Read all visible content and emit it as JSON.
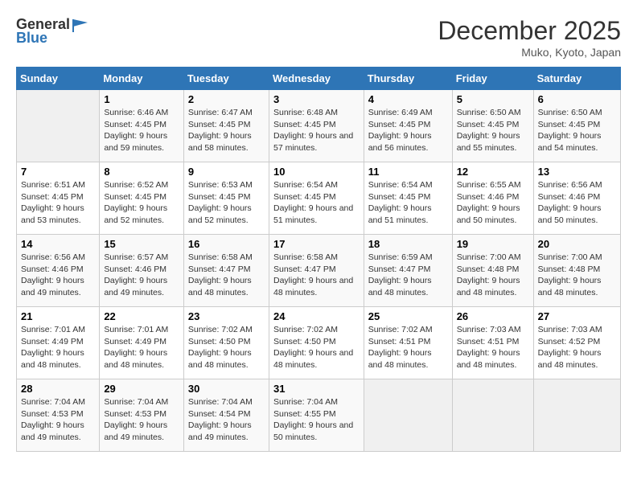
{
  "header": {
    "logo_line1": "General",
    "logo_line2": "Blue",
    "month": "December 2025",
    "location": "Muko, Kyoto, Japan"
  },
  "weekdays": [
    "Sunday",
    "Monday",
    "Tuesday",
    "Wednesday",
    "Thursday",
    "Friday",
    "Saturday"
  ],
  "weeks": [
    [
      {
        "day": "",
        "sunrise": "",
        "sunset": "",
        "daylight": ""
      },
      {
        "day": "1",
        "sunrise": "Sunrise: 6:46 AM",
        "sunset": "Sunset: 4:45 PM",
        "daylight": "Daylight: 9 hours and 59 minutes."
      },
      {
        "day": "2",
        "sunrise": "Sunrise: 6:47 AM",
        "sunset": "Sunset: 4:45 PM",
        "daylight": "Daylight: 9 hours and 58 minutes."
      },
      {
        "day": "3",
        "sunrise": "Sunrise: 6:48 AM",
        "sunset": "Sunset: 4:45 PM",
        "daylight": "Daylight: 9 hours and 57 minutes."
      },
      {
        "day": "4",
        "sunrise": "Sunrise: 6:49 AM",
        "sunset": "Sunset: 4:45 PM",
        "daylight": "Daylight: 9 hours and 56 minutes."
      },
      {
        "day": "5",
        "sunrise": "Sunrise: 6:50 AM",
        "sunset": "Sunset: 4:45 PM",
        "daylight": "Daylight: 9 hours and 55 minutes."
      },
      {
        "day": "6",
        "sunrise": "Sunrise: 6:50 AM",
        "sunset": "Sunset: 4:45 PM",
        "daylight": "Daylight: 9 hours and 54 minutes."
      }
    ],
    [
      {
        "day": "7",
        "sunrise": "Sunrise: 6:51 AM",
        "sunset": "Sunset: 4:45 PM",
        "daylight": "Daylight: 9 hours and 53 minutes."
      },
      {
        "day": "8",
        "sunrise": "Sunrise: 6:52 AM",
        "sunset": "Sunset: 4:45 PM",
        "daylight": "Daylight: 9 hours and 52 minutes."
      },
      {
        "day": "9",
        "sunrise": "Sunrise: 6:53 AM",
        "sunset": "Sunset: 4:45 PM",
        "daylight": "Daylight: 9 hours and 52 minutes."
      },
      {
        "day": "10",
        "sunrise": "Sunrise: 6:54 AM",
        "sunset": "Sunset: 4:45 PM",
        "daylight": "Daylight: 9 hours and 51 minutes."
      },
      {
        "day": "11",
        "sunrise": "Sunrise: 6:54 AM",
        "sunset": "Sunset: 4:45 PM",
        "daylight": "Daylight: 9 hours and 51 minutes."
      },
      {
        "day": "12",
        "sunrise": "Sunrise: 6:55 AM",
        "sunset": "Sunset: 4:46 PM",
        "daylight": "Daylight: 9 hours and 50 minutes."
      },
      {
        "day": "13",
        "sunrise": "Sunrise: 6:56 AM",
        "sunset": "Sunset: 4:46 PM",
        "daylight": "Daylight: 9 hours and 50 minutes."
      }
    ],
    [
      {
        "day": "14",
        "sunrise": "Sunrise: 6:56 AM",
        "sunset": "Sunset: 4:46 PM",
        "daylight": "Daylight: 9 hours and 49 minutes."
      },
      {
        "day": "15",
        "sunrise": "Sunrise: 6:57 AM",
        "sunset": "Sunset: 4:46 PM",
        "daylight": "Daylight: 9 hours and 49 minutes."
      },
      {
        "day": "16",
        "sunrise": "Sunrise: 6:58 AM",
        "sunset": "Sunset: 4:47 PM",
        "daylight": "Daylight: 9 hours and 48 minutes."
      },
      {
        "day": "17",
        "sunrise": "Sunrise: 6:58 AM",
        "sunset": "Sunset: 4:47 PM",
        "daylight": "Daylight: 9 hours and 48 minutes."
      },
      {
        "day": "18",
        "sunrise": "Sunrise: 6:59 AM",
        "sunset": "Sunset: 4:47 PM",
        "daylight": "Daylight: 9 hours and 48 minutes."
      },
      {
        "day": "19",
        "sunrise": "Sunrise: 7:00 AM",
        "sunset": "Sunset: 4:48 PM",
        "daylight": "Daylight: 9 hours and 48 minutes."
      },
      {
        "day": "20",
        "sunrise": "Sunrise: 7:00 AM",
        "sunset": "Sunset: 4:48 PM",
        "daylight": "Daylight: 9 hours and 48 minutes."
      }
    ],
    [
      {
        "day": "21",
        "sunrise": "Sunrise: 7:01 AM",
        "sunset": "Sunset: 4:49 PM",
        "daylight": "Daylight: 9 hours and 48 minutes."
      },
      {
        "day": "22",
        "sunrise": "Sunrise: 7:01 AM",
        "sunset": "Sunset: 4:49 PM",
        "daylight": "Daylight: 9 hours and 48 minutes."
      },
      {
        "day": "23",
        "sunrise": "Sunrise: 7:02 AM",
        "sunset": "Sunset: 4:50 PM",
        "daylight": "Daylight: 9 hours and 48 minutes."
      },
      {
        "day": "24",
        "sunrise": "Sunrise: 7:02 AM",
        "sunset": "Sunset: 4:50 PM",
        "daylight": "Daylight: 9 hours and 48 minutes."
      },
      {
        "day": "25",
        "sunrise": "Sunrise: 7:02 AM",
        "sunset": "Sunset: 4:51 PM",
        "daylight": "Daylight: 9 hours and 48 minutes."
      },
      {
        "day": "26",
        "sunrise": "Sunrise: 7:03 AM",
        "sunset": "Sunset: 4:51 PM",
        "daylight": "Daylight: 9 hours and 48 minutes."
      },
      {
        "day": "27",
        "sunrise": "Sunrise: 7:03 AM",
        "sunset": "Sunset: 4:52 PM",
        "daylight": "Daylight: 9 hours and 48 minutes."
      }
    ],
    [
      {
        "day": "28",
        "sunrise": "Sunrise: 7:04 AM",
        "sunset": "Sunset: 4:53 PM",
        "daylight": "Daylight: 9 hours and 49 minutes."
      },
      {
        "day": "29",
        "sunrise": "Sunrise: 7:04 AM",
        "sunset": "Sunset: 4:53 PM",
        "daylight": "Daylight: 9 hours and 49 minutes."
      },
      {
        "day": "30",
        "sunrise": "Sunrise: 7:04 AM",
        "sunset": "Sunset: 4:54 PM",
        "daylight": "Daylight: 9 hours and 49 minutes."
      },
      {
        "day": "31",
        "sunrise": "Sunrise: 7:04 AM",
        "sunset": "Sunset: 4:55 PM",
        "daylight": "Daylight: 9 hours and 50 minutes."
      },
      {
        "day": "",
        "sunrise": "",
        "sunset": "",
        "daylight": ""
      },
      {
        "day": "",
        "sunrise": "",
        "sunset": "",
        "daylight": ""
      },
      {
        "day": "",
        "sunrise": "",
        "sunset": "",
        "daylight": ""
      }
    ]
  ]
}
